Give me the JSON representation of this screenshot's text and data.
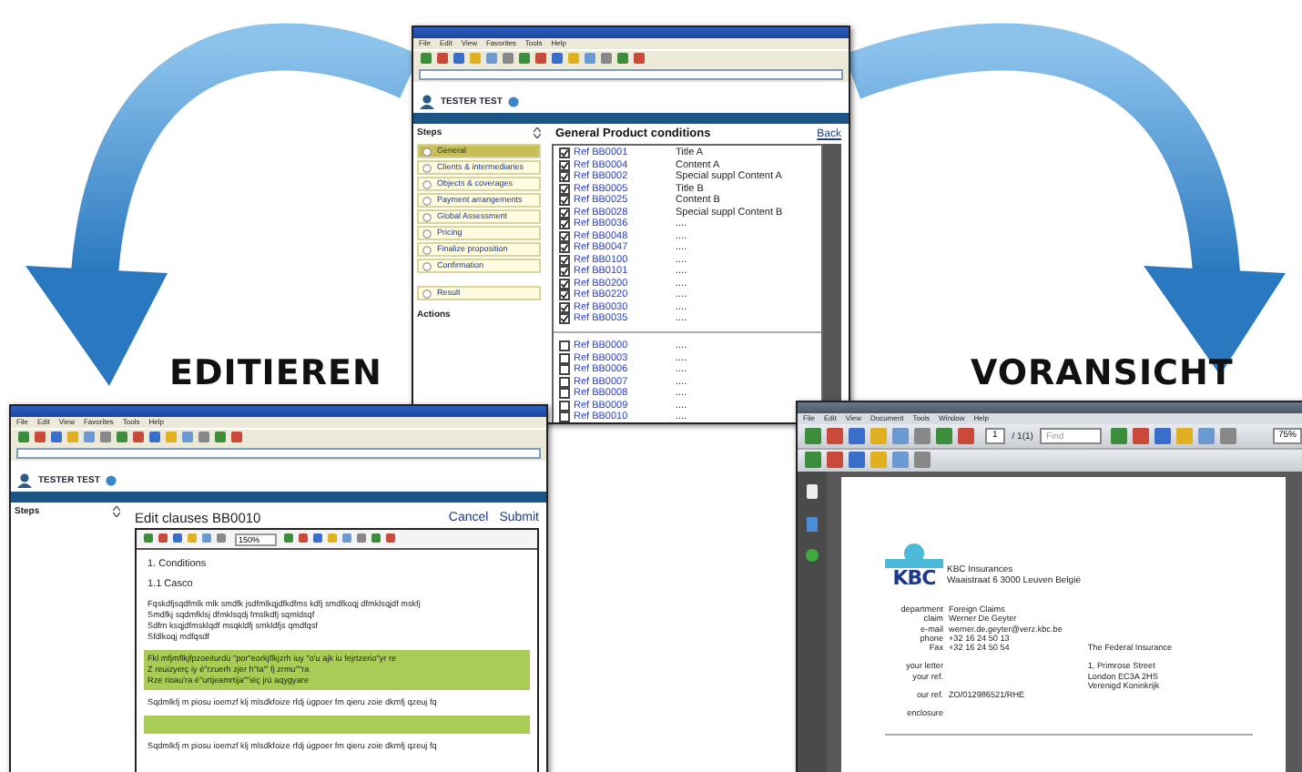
{
  "edit_label": "EDITIEREN",
  "preview_label": "VORANSICHT",
  "overview_window": {
    "menu": [
      "File",
      "Edit",
      "View",
      "Favorites",
      "Tools",
      "Help"
    ],
    "user": "TESTER TEST",
    "steps_title": "Steps",
    "steps": [
      {
        "label": "General",
        "selected": true
      },
      {
        "label": "Clients & intermediaries",
        "selected": false
      },
      {
        "label": "Objects & coverages",
        "selected": false
      },
      {
        "label": "Payment arrangements",
        "selected": false
      },
      {
        "label": "Global Assessment",
        "selected": false
      },
      {
        "label": "Pricing",
        "selected": false
      },
      {
        "label": "Finalize proposition",
        "selected": false
      },
      {
        "label": "Confirmation",
        "selected": false
      }
    ],
    "result_step": {
      "label": "Result",
      "selected": false
    },
    "actions_title": "Actions",
    "title": "General Product conditions",
    "back": "Back",
    "selected_clauses": [
      {
        "ref": "Ref BB0001",
        "content": "Title A",
        "checked": true
      },
      {
        "ref": "Ref BB0004",
        "content": "Content A",
        "checked": true
      },
      {
        "ref": "Ref BB0002",
        "content": "Special suppl Content A",
        "checked": true
      },
      {
        "ref": "Ref BB0005",
        "content": "Title B",
        "checked": true
      },
      {
        "ref": "Ref BB0025",
        "content": "Content B",
        "checked": true
      },
      {
        "ref": "Ref BB0028",
        "content": "Special suppl Content B",
        "checked": true
      },
      {
        "ref": "Ref BB0036",
        "content": "....",
        "checked": true
      },
      {
        "ref": "Ref BB0048",
        "content": "....",
        "checked": true
      },
      {
        "ref": "Ref BB0047",
        "content": "....",
        "checked": true
      },
      {
        "ref": "Ref BB0100",
        "content": "....",
        "checked": true
      },
      {
        "ref": "Ref BB0101",
        "content": "....",
        "checked": true
      },
      {
        "ref": "Ref BB0200",
        "content": "....",
        "checked": true
      },
      {
        "ref": "Ref BB0220",
        "content": "....",
        "checked": true
      },
      {
        "ref": "Ref BB0030",
        "content": "....",
        "checked": true
      },
      {
        "ref": "Ref BB0035",
        "content": "....",
        "checked": true
      }
    ],
    "other_clauses": [
      {
        "ref": "Ref BB0000",
        "content": "....",
        "checked": false
      },
      {
        "ref": "Ref BB0003",
        "content": "....",
        "checked": false
      },
      {
        "ref": "Ref BB0006",
        "content": "....",
        "checked": false
      },
      {
        "ref": "Ref BB0007",
        "content": "....",
        "checked": false
      },
      {
        "ref": "Ref BB0008",
        "content": "....",
        "checked": false
      },
      {
        "ref": "Ref BB0009",
        "content": "....",
        "checked": false
      },
      {
        "ref": "Ref BB0010",
        "content": "....",
        "checked": false
      }
    ]
  },
  "editor_window": {
    "menu": [
      "File",
      "Edit",
      "View",
      "Favorites",
      "Tools",
      "Help"
    ],
    "user": "TESTER TEST",
    "steps_title": "Steps",
    "title": "Edit clauses BB0010",
    "cancel": "Cancel",
    "submit": "Submit",
    "zoom": "150%",
    "paragraphs": [
      {
        "kind": "heading",
        "highlighted": false,
        "lines": [
          "1. Conditions"
        ]
      },
      {
        "kind": "heading",
        "highlighted": false,
        "lines": [
          "1.1 Casco"
        ]
      },
      {
        "kind": "text",
        "highlighted": false,
        "lines": [
          "Fqskdfjsqdfmlk mlk smdfk jsdfmlkqjdfkdfms kdfj smdfkoqj dfmklsqjdf mskfj",
          "Smdfkj sqdmfklsj dfmklsqdj fmslkdfj sqmldsqf",
          "Sdfm ksqjdfmsklqdf msqkldfj smkldfjs qmdfqsf",
          "Sfdlkoqj mdfqsdf"
        ]
      },
      {
        "kind": "text",
        "highlighted": true,
        "lines": [
          "Fkl mfjmflkjfpzoeiturdù \"por\"eorkjflkjzrh  iuy \"o'u ajk iu fejrtzerio\"yr re",
          "Z reuizyerç iy é\"rzuerh zjer h\"ta\"' fj zrmu\"\"ra",
          "Rze rioau'ra é\"urtjeamrtija\"\"iéç jrù aqygyare"
        ]
      },
      {
        "kind": "text",
        "highlighted": false,
        "lines": [
          "Sqdmlkfj m piosu ioemzf klj mlsdkfoize rfdj ùgpoer fm qieru zoie dkmfj qzeuj fq"
        ]
      },
      {
        "kind": "spacer",
        "highlighted": true
      },
      {
        "kind": "text",
        "highlighted": false,
        "lines": [
          "Sqdmlkfj m piosu ioemzf klj mlsdkfoize rfdj ùgpoer fm qieru zoie dkmfj qzeuj fq"
        ]
      }
    ]
  },
  "preview_window": {
    "menu": [
      "File",
      "Edit",
      "View",
      "Document",
      "Tools",
      "Window",
      "Help"
    ],
    "page": "1",
    "page_count": "/ 1(1)",
    "find_placeholder": "Find",
    "zoom": "75%",
    "document": {
      "logo_text": "KBC",
      "company": "KBC Insurances",
      "address": "Waaistraat 6 3000 Leuven België",
      "field_groups": [
        [
          {
            "label": "department",
            "value": "Foreign Claims"
          },
          {
            "label": "claim",
            "value": "Werner De Geyter"
          },
          {
            "label": "e-mail",
            "value": "werner.de.geyter@verz.kbc.be"
          },
          {
            "label": "phone",
            "value": "+32 16 24 50 13"
          },
          {
            "label": "Fax",
            "value": "+32 16 24 50 54"
          }
        ],
        [
          {
            "label": "your letter"
          },
          {
            "label": "your ref."
          }
        ],
        [
          {
            "label": "our ref.",
            "value": "ZO/012986521/RHE"
          }
        ],
        [
          {
            "label": "enclosure"
          }
        ]
      ],
      "recipient": {
        "name": "The Federal Insurance",
        "address": [
          "1, Primrose Street",
          "London EC3A 2HS",
          "Verenigd Koninkrijk"
        ]
      }
    }
  }
}
